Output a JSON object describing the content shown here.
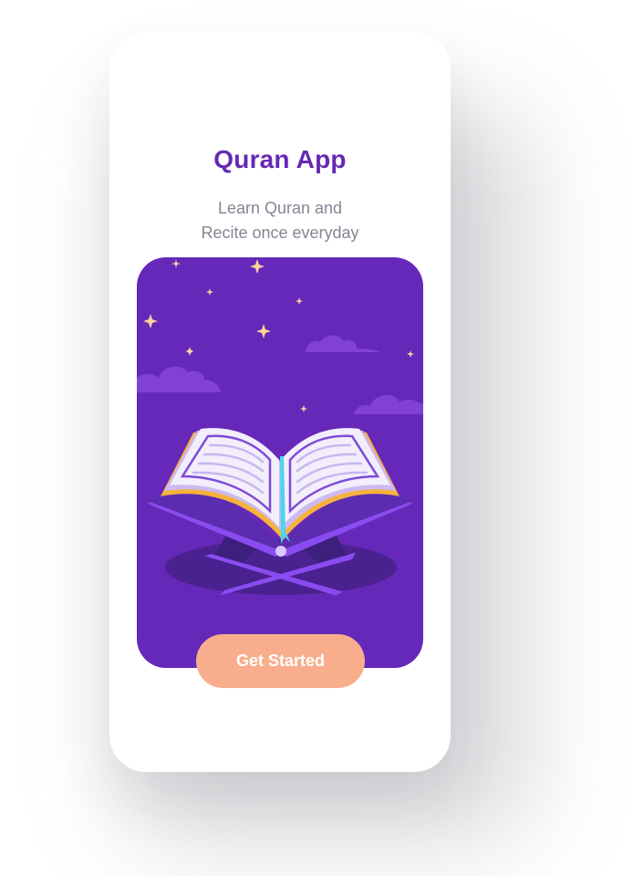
{
  "app": {
    "title": "Quran App",
    "subtitle_line1": "Learn Quran and",
    "subtitle_line2": "Recite once everyday"
  },
  "actions": {
    "get_started_label": "Get Started"
  },
  "illustration": {
    "subject": "open-quran-on-rehal-icon",
    "background": "night-sky-with-stars-and-clouds"
  },
  "colors": {
    "title": "#6528b5",
    "subtitle": "#858594",
    "hero_background": "#6528b9",
    "button": "#f8ae8c",
    "button_text": "#ffffff",
    "star": "#ffd39a",
    "cloud": "#8140d6"
  }
}
